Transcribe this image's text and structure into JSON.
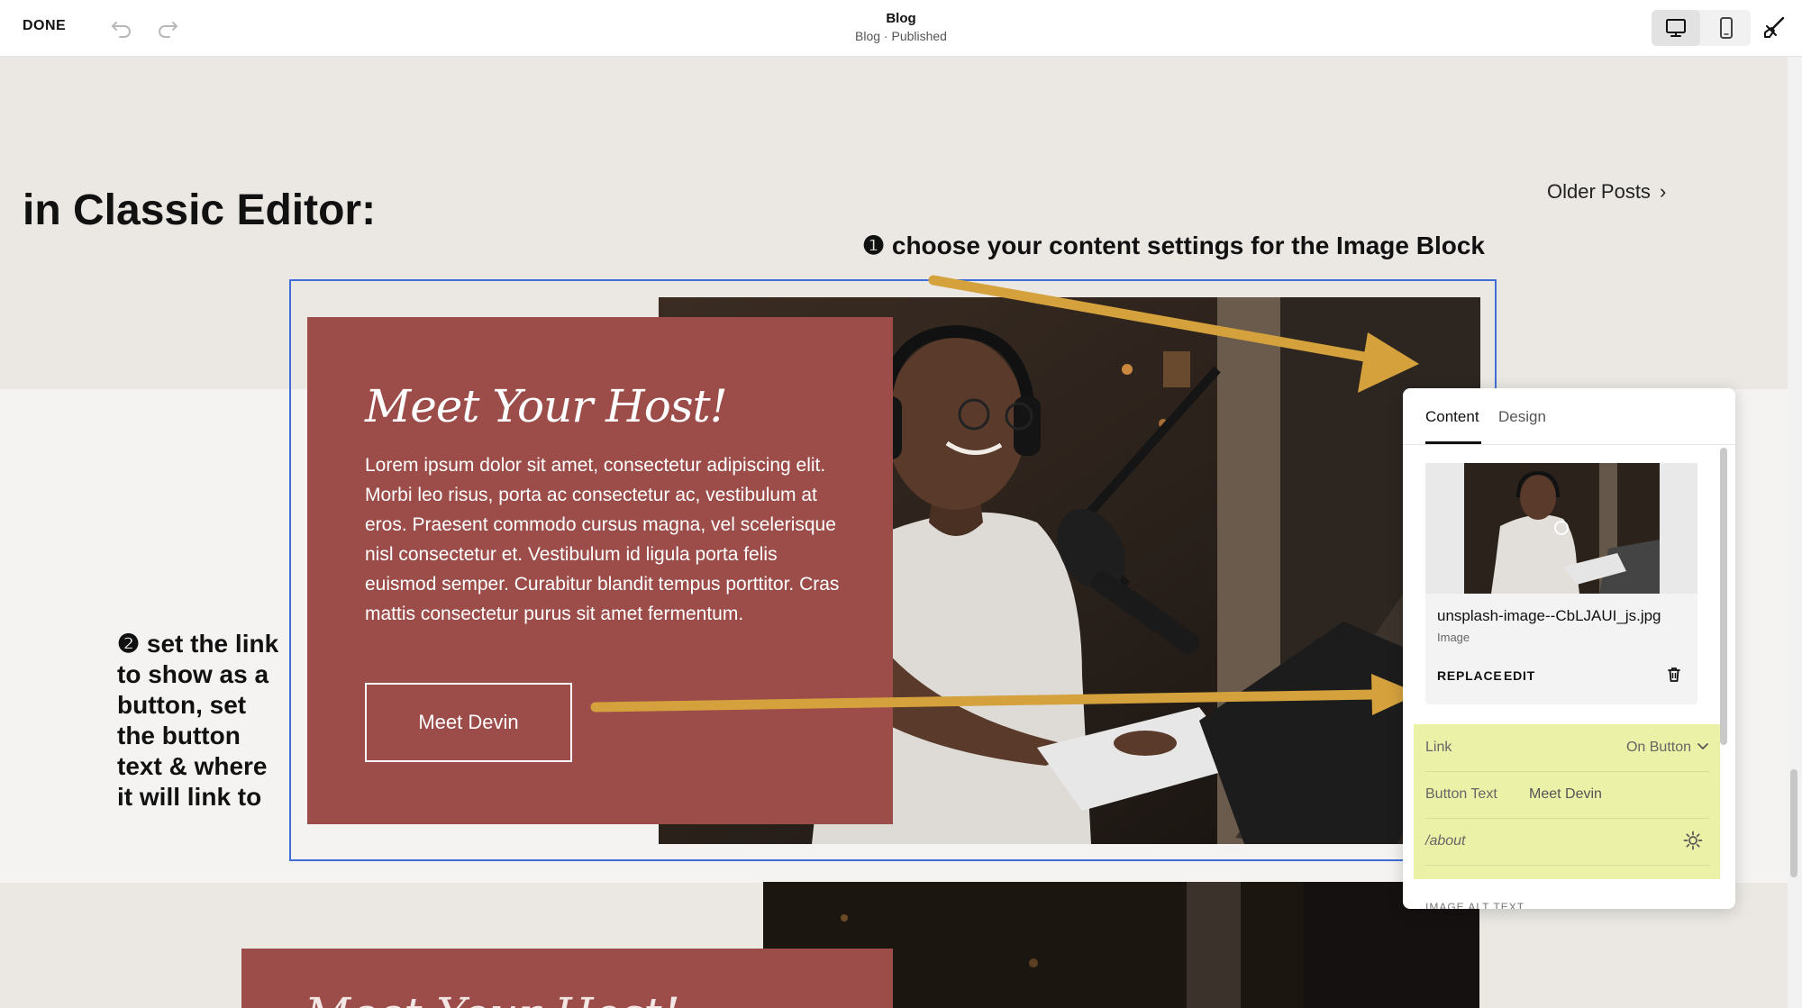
{
  "toolbar": {
    "done_label": "DONE",
    "title": "Blog",
    "subtitle": "Blog · Published"
  },
  "page": {
    "classic_heading": "in Classic Editor:",
    "older_posts_label": "Older Posts",
    "annotation_1": "❶ choose your content settings for the Image Block",
    "annotation_2": "❷ set the link to show as a button, set the button text & where it will link to",
    "card": {
      "heading": "Meet Your Host!",
      "body": "Lorem ipsum dolor sit amet, consectetur adipiscing elit. Morbi leo risus, porta ac consectetur ac, vestibulum at eros. Praesent commodo cursus magna, vel scelerisque nisl consectetur et. Vestibulum id ligula porta felis euismod semper. Curabitur blandit tempus porttitor. Cras mattis consectetur purus sit amet fermentum.",
      "button_label": "Meet Devin"
    },
    "card2_heading": "Meet Your Host!"
  },
  "panel": {
    "tabs": [
      "Content",
      "Design"
    ],
    "image": {
      "file_name": "unsplash-image--CbLJAUI_js.jpg",
      "file_type": "Image",
      "replace_label": "REPLACE",
      "edit_label": "EDIT"
    },
    "link": {
      "label": "Link",
      "value": "On Button",
      "button_text_label": "Button Text",
      "button_text_value": "Meet Devin",
      "url_value": "/about"
    },
    "alt_text_label": "IMAGE ALT TEXT"
  },
  "colors": {
    "card": "#9c4d4a",
    "accent_arrow": "#d4a13c",
    "selection": "#3f6fd6",
    "link_highlight": "#ecf1a8"
  }
}
